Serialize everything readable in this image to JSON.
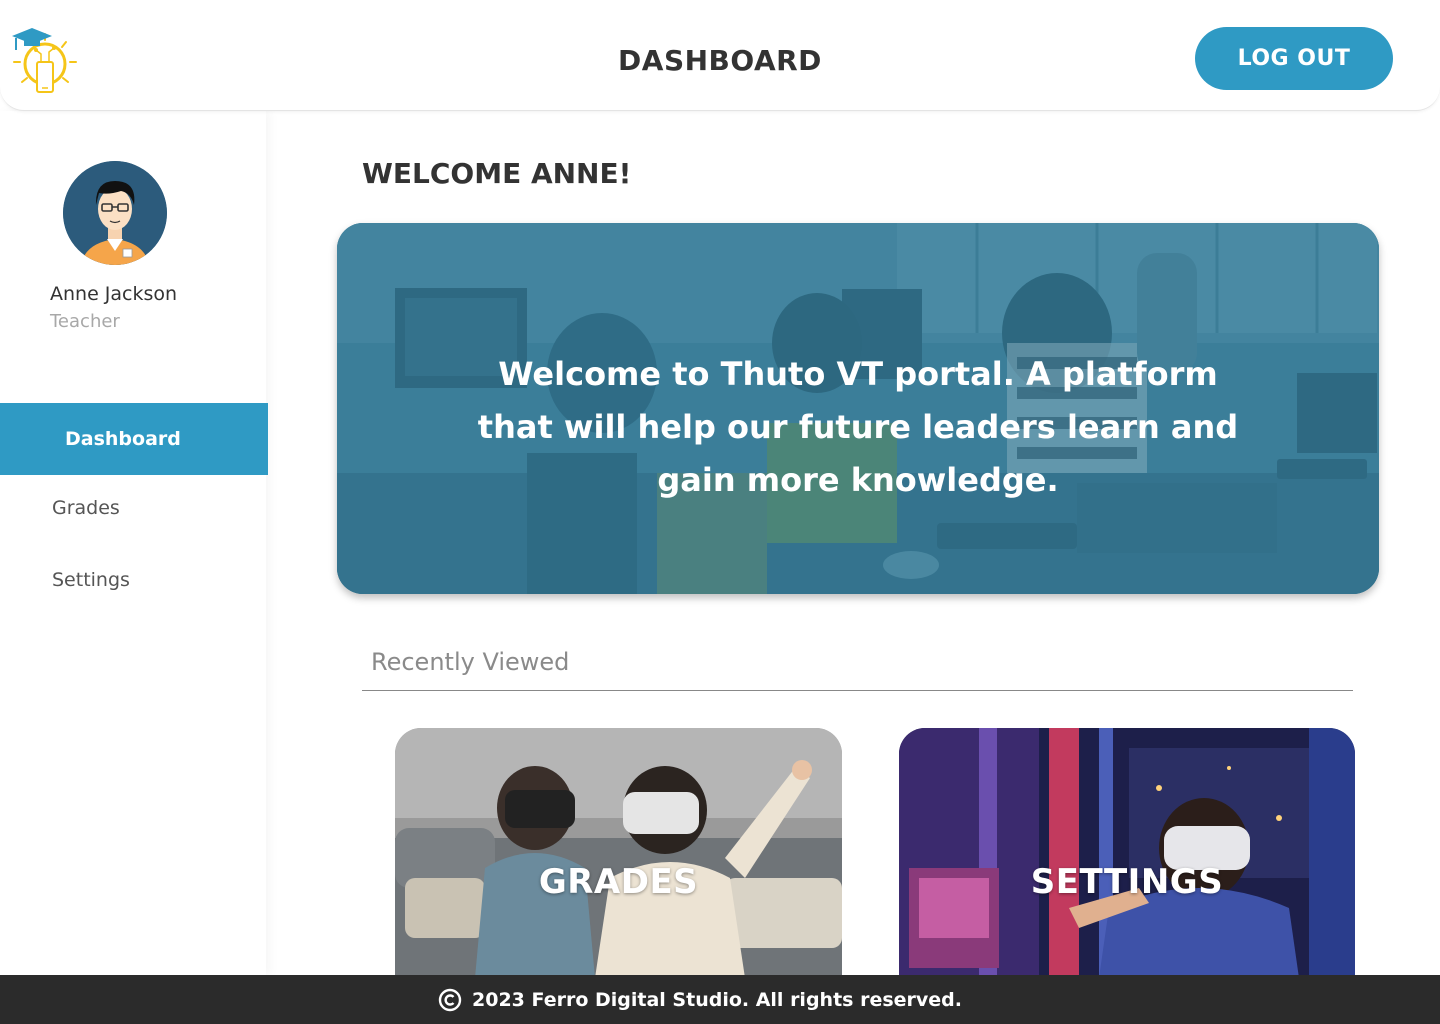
{
  "header": {
    "title": "DASHBOARD",
    "logout_label": "LOG OUT",
    "logo_icon": "lightbulb-graduation-cap-logo"
  },
  "sidebar": {
    "user": {
      "name": "Anne Jackson",
      "role": "Teacher",
      "avatar_icon": "teacher-avatar"
    },
    "items": [
      {
        "label": "Dashboard",
        "active": true
      },
      {
        "label": "Grades",
        "active": false
      },
      {
        "label": "Settings",
        "active": false
      }
    ]
  },
  "main": {
    "welcome": "WELCOME ANNE!",
    "hero_text": "Welcome to Thuto VT portal. A platform that will help our future leaders learn and gain more knowledge.",
    "recently_viewed_label": "Recently Viewed",
    "cards": [
      {
        "title": "GRADES"
      },
      {
        "title": "SETTINGS"
      }
    ]
  },
  "footer": {
    "text": "2023 Ferro Digital Studio. All rights reserved.",
    "icon": "copyright-icon"
  },
  "colors": {
    "accent": "#2f9ac4",
    "text": "#333333",
    "muted": "#a8a8a8",
    "footer_bg": "#2b2b2b",
    "logo_yellow": "#f5c518"
  }
}
